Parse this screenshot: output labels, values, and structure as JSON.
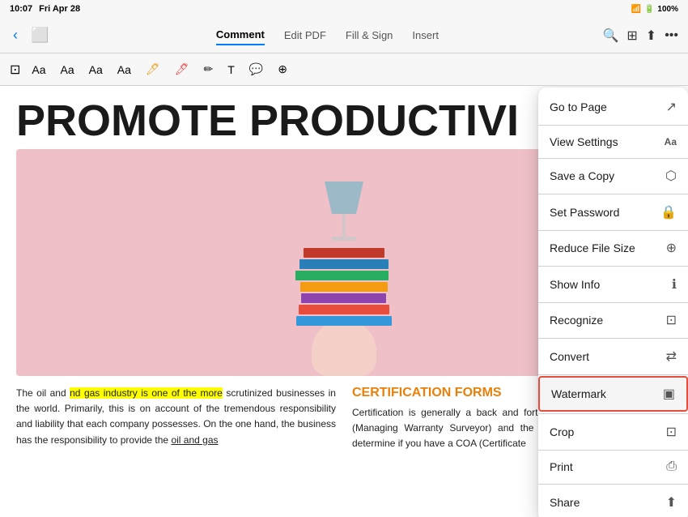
{
  "status_bar": {
    "time": "10:07",
    "day": "Fri Apr 28",
    "battery": "100%",
    "wifi_icon": "wifi",
    "battery_icon": "battery-full"
  },
  "toolbar": {
    "tabs": [
      {
        "label": "Comment",
        "active": true
      },
      {
        "label": "Edit PDF",
        "active": false
      },
      {
        "label": "Fill & Sign",
        "active": false
      },
      {
        "label": "Insert",
        "active": false
      }
    ],
    "more_icon": "•••"
  },
  "pdf": {
    "title": "PROMOTE PRODUCTIVI",
    "col_left": "The oil and gas industry is one of the more scrutinized businesses in the world. Primarily, this is on account of the tremendous responsibility and liability that each company possesses. On the one hand, the business has the responsibility to provide the oil and gas",
    "highlight_text": "nd gas industry is one of the more",
    "cert_title": "CERTIFICATION FORMS",
    "cert_text": "Certification is generally a back and forth of fixes between the MWS (Managing Warranty Surveyor) and the insurer. Since the MWS will determine if you have a COA (Certificate"
  },
  "menu": {
    "items": [
      {
        "label": "Go to Page",
        "icon": "↗",
        "selected": false,
        "id": "go-to-page"
      },
      {
        "label": "View Settings",
        "icon": "Aa",
        "selected": false,
        "id": "view-settings"
      },
      {
        "label": "Save a Copy",
        "icon": "⬡",
        "selected": false,
        "id": "save-a-copy"
      },
      {
        "label": "Set Password",
        "icon": "🔒",
        "selected": false,
        "id": "set-password"
      },
      {
        "label": "Reduce File Size",
        "icon": "⊕",
        "selected": false,
        "id": "reduce-file-size"
      },
      {
        "label": "Show Info",
        "icon": "ℹ",
        "selected": false,
        "id": "show-info"
      },
      {
        "label": "Recognize",
        "icon": "⊡",
        "selected": false,
        "id": "recognize"
      },
      {
        "label": "Convert",
        "icon": "⇄",
        "selected": false,
        "id": "convert"
      },
      {
        "label": "Watermark",
        "icon": "▣",
        "selected": true,
        "id": "watermark"
      },
      {
        "label": "Crop",
        "icon": "⊡",
        "selected": false,
        "id": "crop"
      },
      {
        "label": "Print",
        "icon": "⎙",
        "selected": false,
        "id": "print"
      },
      {
        "label": "Share",
        "icon": "⬆",
        "selected": false,
        "id": "share"
      }
    ]
  }
}
